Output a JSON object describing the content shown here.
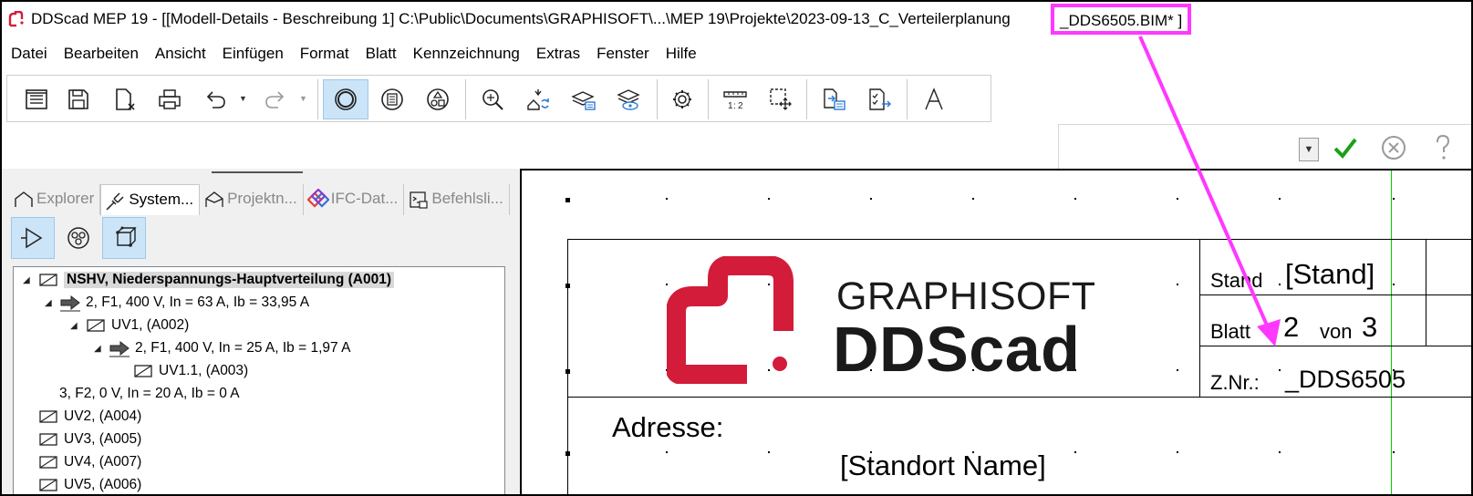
{
  "window": {
    "title": "DDScad MEP 19 - [[Modell-Details - Beschreibung 1]  C:\\Public\\Documents\\GRAPHISOFT\\...\\MEP 19\\Projekte\\2023-09-13_C_Verteilerplanung",
    "title_file": "_DDS6505.BIM* ]",
    "annotation_color": "#ff38ff"
  },
  "menu": [
    "Datei",
    "Bearbeiten",
    "Ansicht",
    "Einfügen",
    "Format",
    "Blatt",
    "Kennzeichnung",
    "Extras",
    "Fenster",
    "Hilfe"
  ],
  "panel": {
    "tabs": [
      {
        "label": "Explorer",
        "icon": "explorer-house-icon"
      },
      {
        "label": "System...",
        "icon": "system-plug-icon"
      },
      {
        "label": "Projektn...",
        "icon": "project-house-icon"
      },
      {
        "label": "IFC-Dat...",
        "icon": "ifc-logo-icon"
      },
      {
        "label": "Befehlsli...",
        "icon": "command-list-icon"
      }
    ],
    "tree": [
      {
        "label": "NSHV, Niederspannungs-Hauptverteilung (A001)",
        "level": 0,
        "icon": "distribution-board-icon",
        "expanded": true,
        "selected": true
      },
      {
        "label": "2, F1, 400 V, In = 63 A, Ib = 33,95 A",
        "level": 1,
        "icon": "circuit-arrow-icon",
        "expanded": true
      },
      {
        "label": "UV1,  (A002)",
        "level": 2,
        "icon": "distribution-board-icon",
        "expanded": true
      },
      {
        "label": "2, F1, 400 V, In = 25 A, Ib = 1,97 A",
        "level": 3,
        "icon": "circuit-arrow-icon",
        "expanded": true
      },
      {
        "label": "UV1.1,  (A003)",
        "level": 4,
        "icon": "distribution-board-icon"
      },
      {
        "label": "3, F2, 0 V, In = 20 A, Ib = 0 A",
        "level": 1,
        "icon": "none"
      },
      {
        "label": "UV2,  (A004)",
        "level": 0,
        "icon": "distribution-board-icon"
      },
      {
        "label": "UV3,  (A005)",
        "level": 0,
        "icon": "distribution-board-icon"
      },
      {
        "label": "UV4,  (A007)",
        "level": 0,
        "icon": "distribution-board-icon"
      },
      {
        "label": "UV5,  (A006)",
        "level": 0,
        "icon": "distribution-board-icon"
      }
    ]
  },
  "titleblock": {
    "logo_line1": "GRAPHISOFT",
    "logo_line2": "DDScad",
    "stand_label": "Stand",
    "stand_value": "[Stand]",
    "blatt_label": "Blatt",
    "blatt_value": "2",
    "von_label": "von",
    "von_value": "3",
    "znr_label": "Z.Nr.:",
    "znr_value": "_DDS6505",
    "address_label": "Adresse:",
    "standort_value": "[Standort Name]",
    "logo_color": "#d31c3a"
  }
}
